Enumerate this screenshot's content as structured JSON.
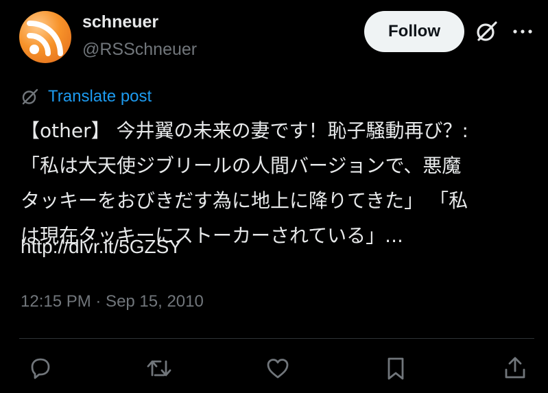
{
  "author": {
    "display_name": "schneuer",
    "handle": "@RSSchneuer",
    "avatar_icon": "rss-feed-icon"
  },
  "header": {
    "follow_label": "Follow",
    "grok_icon": "grok-icon",
    "more_icon": "more-horizontal-icon"
  },
  "translate": {
    "label": "Translate post",
    "icon": "grok-translate-icon"
  },
  "post": {
    "lines": [
      "【other】 今井翼の未来の妻です！恥子騒動再び？:",
      "「私は大天使ジブリールの人間バージョンで、悪魔",
      "タッキーをおびきだす為に地上に降りてきた」 「私",
      "は現在タッキーにストーカーされている」..."
    ],
    "link": "http://dlvr.it/5GZSY",
    "timestamp": "12:15 PM · Sep 15, 2010"
  },
  "actions": [
    {
      "name": "reply",
      "icon": "reply-icon"
    },
    {
      "name": "repost",
      "icon": "repost-icon"
    },
    {
      "name": "like",
      "icon": "heart-icon"
    },
    {
      "name": "bookmark",
      "icon": "bookmark-icon"
    },
    {
      "name": "share",
      "icon": "share-icon"
    }
  ],
  "colors": {
    "background": "#000000",
    "text": "#e7e9ea",
    "secondary_text": "#71767b",
    "link": "#1d9bf0",
    "button_bg": "#eff3f4",
    "divider": "#2f3336"
  }
}
